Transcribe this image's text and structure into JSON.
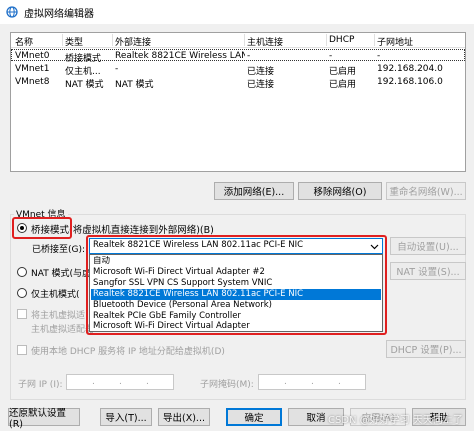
{
  "window": {
    "title": "虚拟网络编辑器",
    "icon": "network-icon"
  },
  "table": {
    "headers": [
      "名称",
      "类型",
      "外部连接",
      "主机连接",
      "DHCP",
      "子网地址"
    ],
    "rows": [
      [
        "VMnet0",
        "桥接模式",
        "Realtek 8821CE Wireless LAN ...",
        "-",
        "-",
        "-"
      ],
      [
        "VMnet1",
        "仅主机...",
        "-",
        "已连接",
        "已启用",
        "192.168.204.0"
      ],
      [
        "VMnet8",
        "NAT 模式",
        "NAT 模式",
        "已连接",
        "已启用",
        "192.168.106.0"
      ]
    ]
  },
  "network_buttons": {
    "add": "添加网络(E)...",
    "remove": "移除网络(O)",
    "rename": "重命名网络(W)..."
  },
  "vmnet_info": {
    "label": "VMnet 信息",
    "bridged_label": "桥接模式(将虚拟机直接连接到外部网络)(B)",
    "bridged_to_label": "已桥接至(G):",
    "bridged_to_value": "Realtek 8821CE Wireless LAN 802.11ac PCI-E NIC",
    "auto_settings": "自动设置(U)...",
    "nat_label": "NAT 模式(与虚",
    "nat_settings": "NAT 设置(S)...",
    "host_only_label": "仅主机模式(",
    "connect_host_adapter_line1": "将主机虚拟适",
    "connect_host_adapter_line2": "主机虚拟适配器",
    "dhcp_label": "使用本地 DHCP 服务将 IP 地址分配给虚拟机(D)",
    "dhcp_settings": "DHCP 设置(P)...",
    "subnet_ip_label": "子网 IP (I):",
    "subnet_mask_label": "子网掩码(M):",
    "ip_sep": "."
  },
  "dropdown": {
    "options": [
      "自动",
      "Microsoft Wi-Fi Direct Virtual Adapter #2",
      "Sangfor SSL VPN CS Support System VNIC",
      "Realtek 8821CE Wireless LAN 802.11ac PCI-E NIC",
      "Bluetooth Device (Personal Area Network)",
      "Realtek PCIe GbE Family Controller",
      "Microsoft Wi-Fi Direct Virtual Adapter"
    ],
    "selected_index": 3
  },
  "footer": {
    "restore": "还原默认设置(R)",
    "import": "导入(T)...",
    "export": "导出(X)...",
    "ok": "确定",
    "cancel": "取消",
    "apply": "应用(A)",
    "help": "帮助"
  },
  "watermark": "CSDN @好好学习 天天向上了",
  "colors": {
    "accent": "#0078d7",
    "highlight_box": "#e02020"
  }
}
